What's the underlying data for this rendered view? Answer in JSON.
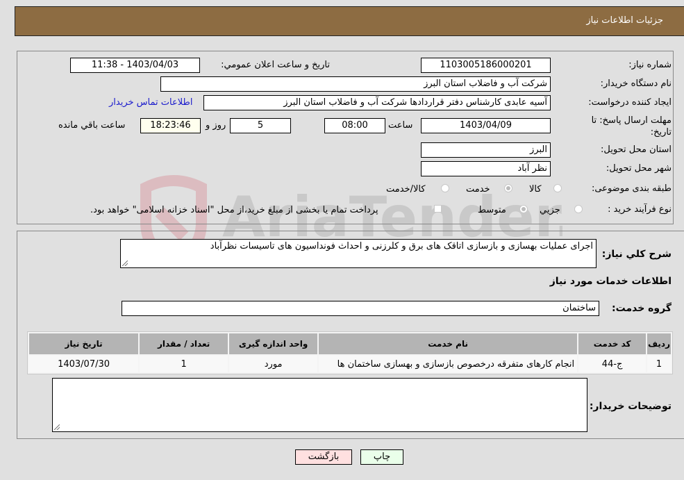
{
  "header": {
    "title": "جزئیات اطلاعات نیاز"
  },
  "fields": {
    "need_number": {
      "label": "شماره نیاز:",
      "value": "1103005186000201"
    },
    "announce_datetime": {
      "label": "تاريخ و ساعت اعلان عمومي:",
      "value": "1403/04/03 - 11:38"
    },
    "buyer_org": {
      "label": "نام دستگاه خریدار:",
      "value": "شرکت آب و فاضلاب استان البرز"
    },
    "requester": {
      "label": "ایجاد کننده درخواست:",
      "value": "آسیه عابدی کارشناس دفتر قراردادها شرکت آب و فاضلاب استان البرز",
      "contact_link": "اطلاعات تماس خریدار"
    },
    "deadline": {
      "label": "مهلت ارسال پاسخ: تا تاریخ:",
      "date": "1403/04/09",
      "time_label": "ساعت",
      "time": "08:00",
      "days": "5",
      "days_label": "روز و",
      "remaining": "18:23:46",
      "remaining_label": "ساعت باقي مانده"
    },
    "delivery_province": {
      "label": "استان محل تحویل:",
      "value": "البرز"
    },
    "delivery_city": {
      "label": "شهر محل تحویل:",
      "value": "نظر آباد"
    },
    "category": {
      "label": "طبقه بندی موضوعی:",
      "options": [
        "کالا",
        "خدمت",
        "کالا/خدمت"
      ],
      "selected": "خدمت"
    },
    "process_type": {
      "label": "نوع فرآیند خرید :",
      "options": [
        "جزيي",
        "متوسط"
      ],
      "selected": "متوسط",
      "treasury_note": "پرداخت تمام یا بخشی از مبلغ خرید،از محل \"اسناد خزانه اسلامی\" خواهد بود."
    }
  },
  "description": {
    "label": "شرح كلي نياز:",
    "value": "اجرای عملیات بهسازی و بازسازی اتاقک های برق و کلرزنی و احداث فونداسیون های تاسیسات نظرآباد"
  },
  "services_section": {
    "title": "اطلاعات خدمات مورد نیاز"
  },
  "service_group": {
    "label": "گروه خدمت:",
    "value": "ساختمان"
  },
  "table": {
    "headers": [
      "ردیف",
      "کد خدمت",
      "نام خدمت",
      "واحد اندازه گیری",
      "تعداد / مقدار",
      "تاریخ نیاز"
    ],
    "rows": [
      [
        "1",
        "ج-44",
        "انجام کارهای متفرقه درخصوص بازسازی و بهسازی ساختمان ها",
        "مورد",
        "1",
        "1403/07/30"
      ]
    ]
  },
  "buyer_notes": {
    "label": "توضیحات خریدار:",
    "value": ""
  },
  "buttons": {
    "print": "چاپ",
    "back": "بازگشت"
  },
  "watermark": {
    "text": "AriaTender.neT"
  },
  "colors": {
    "header_bg": "#8d6c42",
    "print_bg": "#eaffea",
    "back_bg": "#ffe0e0",
    "remaining_bg": "#ffffee",
    "link": "#1a1acc"
  }
}
